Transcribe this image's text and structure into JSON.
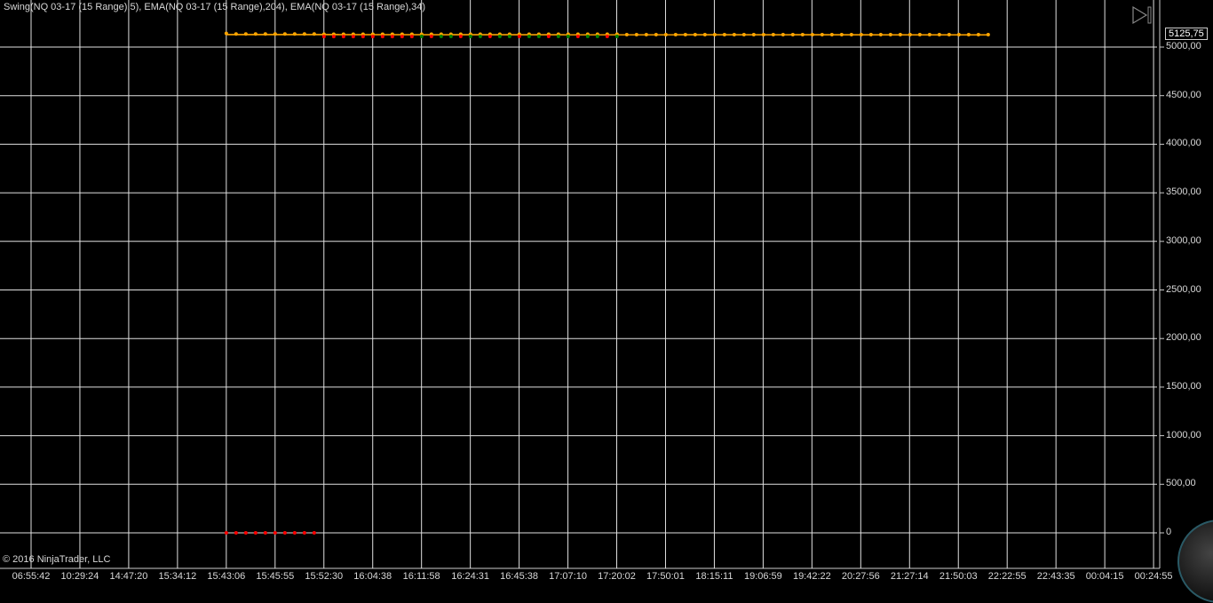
{
  "header": {
    "title": "Swing(NQ 03-17 (15 Range),5), EMA(NQ 03-17 (15 Range),204), EMA(NQ 03-17 (15 Range),34)"
  },
  "footer": {
    "copyright": "© 2016 NinjaTrader, LLC"
  },
  "price_marker": "5125,75",
  "colors": {
    "swing_high": "#ffa500",
    "swing_low_red": "#ff0000",
    "swing_low_green": "#008000",
    "ema": "#ffa500",
    "grid": "#e0e0e0"
  },
  "chart_data": {
    "type": "line",
    "title": "Swing(NQ 03-17 (15 Range),5), EMA(NQ 03-17 (15 Range),204), EMA(NQ 03-17 (15 Range),34)",
    "ylim": [
      0,
      5250
    ],
    "y_ticks": [
      "5000,00",
      "4500,00",
      "4000,00",
      "3500,00",
      "3000,00",
      "2500,00",
      "2000,00",
      "1500,00",
      "1000,00",
      "500,00",
      "0"
    ],
    "y_tick_values": [
      5000,
      4500,
      4000,
      3500,
      3000,
      2500,
      2000,
      1500,
      1000,
      500,
      0
    ],
    "x_ticks": [
      "06:55:42",
      "10:29:24",
      "14:47:20",
      "15:34:12",
      "15:43:06",
      "15:45:55",
      "15:52:30",
      "16:04:38",
      "16:11:58",
      "16:24:31",
      "16:45:38",
      "17:07:10",
      "17:20:02",
      "17:50:01",
      "18:15:11",
      "19:06:59",
      "19:42:22",
      "20:27:56",
      "21:27:14",
      "21:50:03",
      "22:22:55",
      "22:43:35",
      "00:04:15",
      "00:24:55"
    ],
    "bars_start_tick": 4,
    "series": [
      {
        "name": "Swing high",
        "values": [
          5140,
          5135,
          5135,
          5135,
          5135,
          5135,
          5135,
          5135,
          5135,
          5135,
          5132,
          5132,
          5132,
          5132,
          5132,
          5132,
          5132,
          5132,
          5132,
          5132,
          5132,
          5132,
          5132,
          5132,
          5132,
          5132,
          5132,
          5132,
          5132,
          5132,
          5132,
          5132,
          5132,
          5132,
          5132,
          5132,
          5132,
          5132,
          5132,
          5132,
          5132,
          5128,
          5128,
          5128,
          5128,
          5128,
          5128,
          5128,
          5128,
          5128,
          5128,
          5128,
          5128,
          5128,
          5128,
          5128,
          5128,
          5128,
          5128,
          5128,
          5128,
          5128,
          5128,
          5128,
          5128,
          5128,
          5128,
          5128,
          5128,
          5128,
          5128,
          5128,
          5128,
          5128,
          5128,
          5128,
          5128,
          5128,
          5128
        ]
      },
      {
        "name": "Swing low",
        "values": [
          0,
          0,
          0,
          0,
          0,
          0,
          0,
          0,
          0,
          0,
          5108,
          5108,
          5108,
          5108,
          5108,
          5108,
          5108,
          5108,
          5108,
          5108,
          5110,
          5110,
          5110,
          5110,
          5110,
          5110,
          5110,
          5110,
          5110,
          5110,
          5110,
          5110,
          5110,
          5110,
          5110,
          5110,
          5110,
          5110,
          5110,
          5110,
          5110,
          null,
          null,
          null,
          null,
          null,
          null,
          null,
          null,
          null,
          null,
          null,
          null,
          null,
          null,
          null,
          null,
          null,
          null,
          null,
          null,
          null,
          null,
          null,
          null,
          null,
          null,
          null,
          null,
          null,
          null,
          null,
          null,
          null,
          null,
          null,
          null,
          null,
          null
        ]
      },
      {
        "name": "EMA 204",
        "values": [
          5128,
          5125.75
        ]
      },
      {
        "name": "EMA 34",
        "values": [
          5130,
          5125.75
        ]
      }
    ]
  }
}
